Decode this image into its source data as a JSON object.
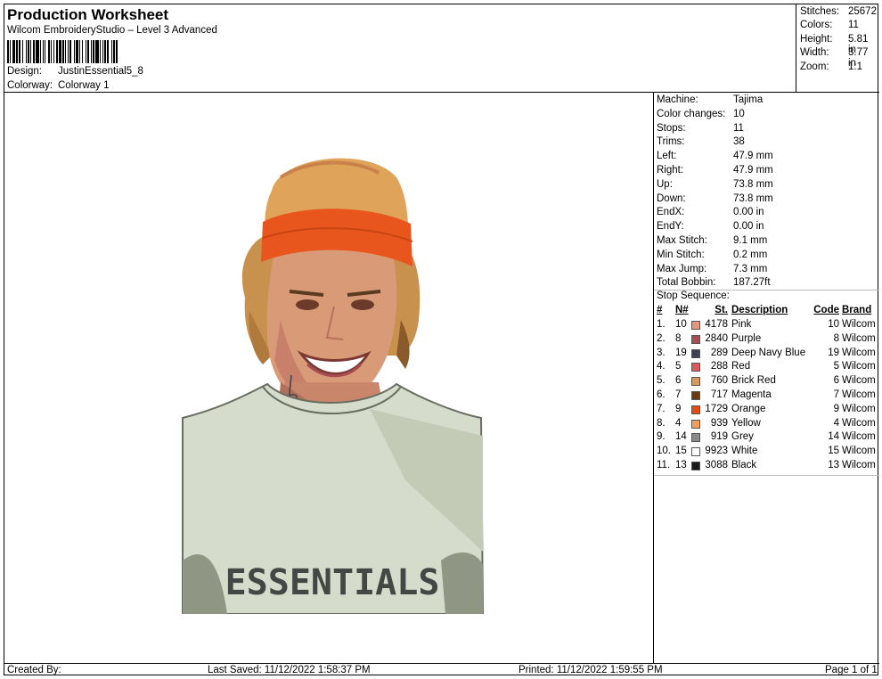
{
  "header": {
    "title": "Production Worksheet",
    "software": "Wilcom EmbroideryStudio – Level 3 Advanced",
    "design_label": "Design:",
    "design_value": "JustinEssential5_8",
    "colorway_label": "Colorway:",
    "colorway_value": "Colorway 1"
  },
  "stats": [
    {
      "label": "Stitches:",
      "value": "25672"
    },
    {
      "label": "Colors:",
      "value": "11"
    },
    {
      "label": "Height:",
      "value": "5.81 in"
    },
    {
      "label": "Width:",
      "value": "3.77 in"
    },
    {
      "label": "Zoom:",
      "value": "1:1"
    }
  ],
  "machine_info": [
    {
      "label": "Machine:",
      "value": "Tajima"
    },
    {
      "label": "Color changes:",
      "value": "10"
    },
    {
      "label": "Stops:",
      "value": "11"
    },
    {
      "label": "Trims:",
      "value": "38"
    },
    {
      "label": "Left:",
      "value": "47.9 mm"
    },
    {
      "label": "Right:",
      "value": "47.9 mm"
    },
    {
      "label": "Up:",
      "value": "73.8 mm"
    },
    {
      "label": "Down:",
      "value": "73.8 mm"
    },
    {
      "label": "EndX:",
      "value": "0.00 in"
    },
    {
      "label": "EndY:",
      "value": "0.00 in"
    },
    {
      "label": "Max Stitch:",
      "value": "9.1 mm"
    },
    {
      "label": "Min Stitch:",
      "value": "0.2 mm"
    },
    {
      "label": "Max Jump:",
      "value": "7.3 mm"
    },
    {
      "label": "Total Bobbin:",
      "value": "187.27ft"
    }
  ],
  "stop_sequence": {
    "title": "Stop Sequence:",
    "headers": {
      "idx": "#",
      "n": "N#",
      "st": "St.",
      "desc": "Description",
      "code": "Code",
      "brand": "Brand"
    },
    "rows": [
      {
        "idx": "1.",
        "n": "10",
        "color": "#e8957e",
        "st": "4178",
        "desc": "Pink",
        "code": "10",
        "brand": "Wilcom"
      },
      {
        "idx": "2.",
        "n": "8",
        "color": "#a84e52",
        "st": "2840",
        "desc": "Purple",
        "code": "8",
        "brand": "Wilcom"
      },
      {
        "idx": "3.",
        "n": "19",
        "color": "#3d3f52",
        "st": "289",
        "desc": "Deep Navy Blue",
        "code": "19",
        "brand": "Wilcom"
      },
      {
        "idx": "4.",
        "n": "5",
        "color": "#d9595c",
        "st": "288",
        "desc": "Red",
        "code": "5",
        "brand": "Wilcom"
      },
      {
        "idx": "5.",
        "n": "6",
        "color": "#d99a5c",
        "st": "760",
        "desc": "Brick Red",
        "code": "6",
        "brand": "Wilcom"
      },
      {
        "idx": "6.",
        "n": "7",
        "color": "#6b3a14",
        "st": "717",
        "desc": "Magenta",
        "code": "7",
        "brand": "Wilcom"
      },
      {
        "idx": "7.",
        "n": "9",
        "color": "#e84a12",
        "st": "1729",
        "desc": "Orange",
        "code": "9",
        "brand": "Wilcom"
      },
      {
        "idx": "8.",
        "n": "4",
        "color": "#f2a05a",
        "st": "939",
        "desc": "Yellow",
        "code": "4",
        "brand": "Wilcom"
      },
      {
        "idx": "9.",
        "n": "14",
        "color": "#8a8a8a",
        "st": "919",
        "desc": "Grey",
        "code": "14",
        "brand": "Wilcom"
      },
      {
        "idx": "10.",
        "n": "15",
        "color": "#ffffff",
        "st": "9923",
        "desc": "White",
        "code": "15",
        "brand": "Wilcom"
      },
      {
        "idx": "11.",
        "n": "13",
        "color": "#1a1a1a",
        "st": "3088",
        "desc": "Black",
        "code": "13",
        "brand": "Wilcom"
      }
    ]
  },
  "design": {
    "shirt_text": "ESSENTIALS"
  },
  "footer": {
    "created": "Created By:",
    "saved": "Last Saved: 11/12/2022 1:58:37 PM",
    "printed": "Printed: 11/12/2022 1:59:55 PM",
    "page": "Page 1 of 1"
  }
}
